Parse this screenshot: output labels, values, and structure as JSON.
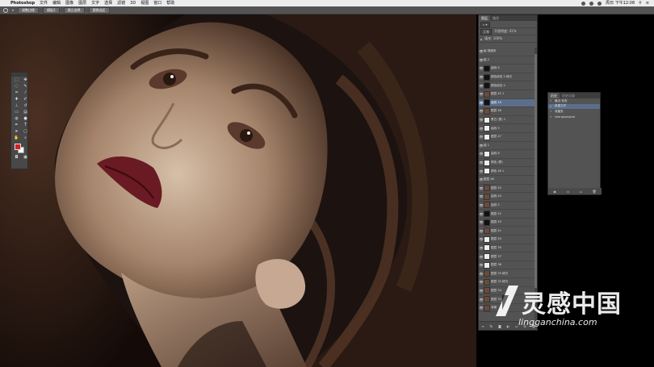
{
  "menubar": {
    "app_name": "Photoshop",
    "items": [
      "文件",
      "编辑",
      "图像",
      "图层",
      "文字",
      "选择",
      "滤镜",
      "3D",
      "视图",
      "窗口",
      "帮助"
    ],
    "clock": "周日 下午12:08"
  },
  "options_bar": {
    "buttons": [
      "调整边缘",
      "模板1",
      "建立选择",
      "替换选区"
    ]
  },
  "layers_panel": {
    "tabs": [
      "图层",
      "路径"
    ],
    "blend_mode": "正常",
    "opacity": "不透明度: 41%",
    "fill": "填充: 100%",
    "rows": [
      {
        "name": "组 视频来",
        "thumb": "none",
        "selected": false
      },
      {
        "name": "组 2",
        "thumb": "none",
        "selected": false
      },
      {
        "name": "曲线 6",
        "thumb": "blk",
        "selected": false
      },
      {
        "name": "颜色填充 5 拷贝",
        "thumb": "blk",
        "selected": false
      },
      {
        "name": "颜色填充 4",
        "thumb": "blk",
        "selected": false
      },
      {
        "name": "图层 42 1",
        "thumb": "img",
        "selected": false
      },
      {
        "name": "曲线 10",
        "thumb": "blk",
        "selected": true
      },
      {
        "name": "图层 48",
        "thumb": "img",
        "selected": false
      },
      {
        "name": "黑白 (蒙) 1",
        "thumb": "wht",
        "selected": false
      },
      {
        "name": "曲线 9",
        "thumb": "wht",
        "selected": false
      },
      {
        "name": "图层 47",
        "thumb": "wht",
        "selected": false
      },
      {
        "name": "组 1",
        "thumb": "none",
        "selected": false
      },
      {
        "name": "曲线 8",
        "thumb": "wht",
        "selected": false
      },
      {
        "name": "颜色 (蒙)",
        "thumb": "wht",
        "selected": false
      },
      {
        "name": "颜色 46 1",
        "thumb": "wht",
        "selected": false
      },
      {
        "name": "图层 46",
        "thumb": "none",
        "selected": false
      },
      {
        "name": "图层 45",
        "thumb": "img",
        "selected": false
      },
      {
        "name": "曲线 44",
        "thumb": "img",
        "selected": false
      },
      {
        "name": "曲线 5",
        "thumb": "img",
        "selected": false
      },
      {
        "name": "图层 42",
        "thumb": "blk",
        "selected": false
      },
      {
        "name": "图层 43",
        "thumb": "blk",
        "selected": false
      },
      {
        "name": "图层 41",
        "thumb": "img",
        "selected": false
      },
      {
        "name": "图层 40",
        "thumb": "wht",
        "selected": false
      },
      {
        "name": "图层 39",
        "thumb": "wht",
        "selected": false
      },
      {
        "name": "图层 37",
        "thumb": "wht",
        "selected": false
      },
      {
        "name": "图层 36",
        "thumb": "wht",
        "selected": false
      },
      {
        "name": "图层 35 拷贝",
        "thumb": "img",
        "selected": false
      },
      {
        "name": "图层 35 拷贝",
        "thumb": "img",
        "selected": false
      },
      {
        "name": "图层 34",
        "thumb": "img",
        "selected": false
      },
      {
        "name": "图层 33",
        "thumb": "img",
        "selected": false
      },
      {
        "name": "背景",
        "thumb": "img",
        "selected": false
      }
    ]
  },
  "history_panel": {
    "tabs": [
      "历史",
      "历史记录"
    ],
    "rows": [
      {
        "name": "最近 状态",
        "selected": false
      },
      {
        "name": "新建文件",
        "selected": true
      },
      {
        "name": "收藏夹",
        "selected": false
      },
      {
        "name": "zhangsanghai",
        "selected": false
      }
    ]
  },
  "watermark": {
    "cn": "灵感中国",
    "url": "lingganchina.com"
  },
  "colors": {
    "foreground": "#d21f23",
    "background": "#ffffff",
    "selection": "#5b6e8c",
    "panel": "#535353"
  }
}
